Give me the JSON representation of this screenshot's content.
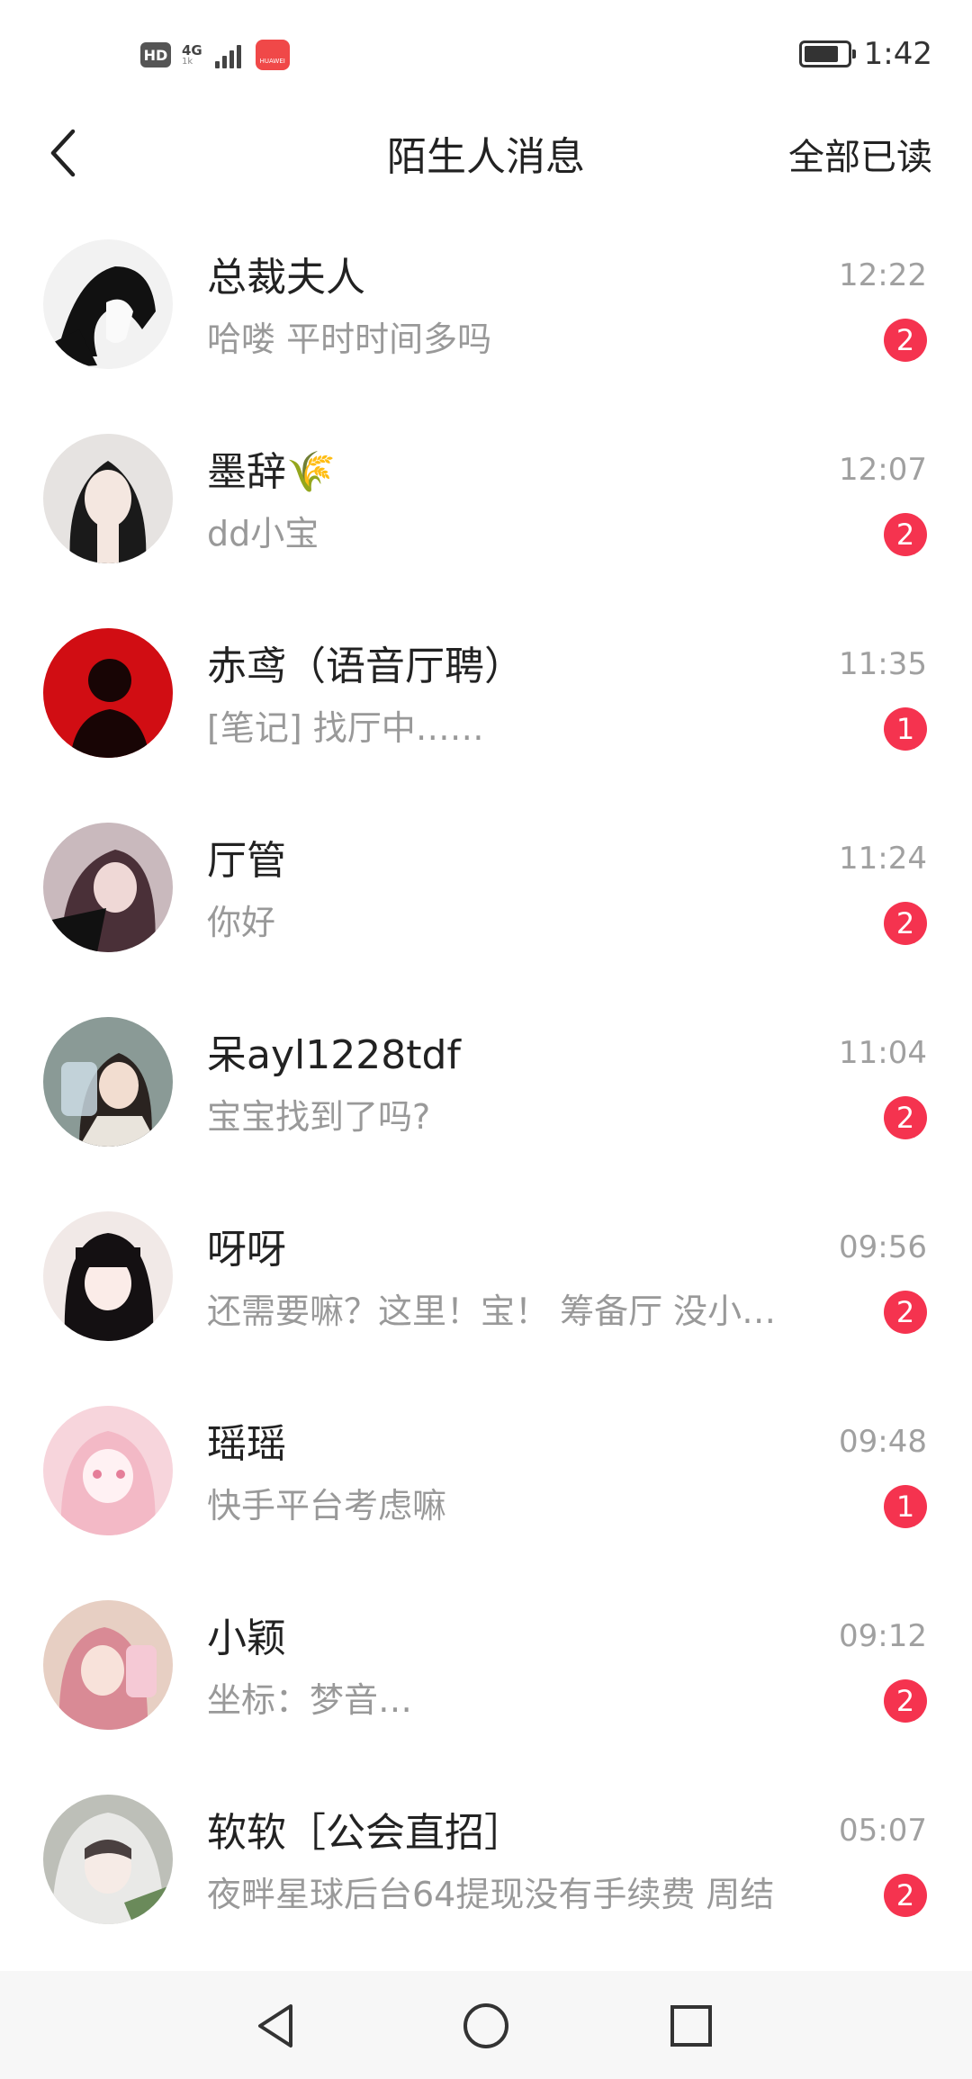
{
  "status_bar": {
    "hd": "HD",
    "network": "4G",
    "network_sub": "1k",
    "app_badge": "HUAWEI",
    "time": "1:42"
  },
  "header": {
    "title": "陌生人消息",
    "mark_all_read": "全部已读"
  },
  "messages": [
    {
      "name": "总裁夫人",
      "preview": "哈喽 平时时间多吗",
      "time": "12:22",
      "unread": "2"
    },
    {
      "name": "墨辞🌾",
      "preview": "dd小宝",
      "time": "12:07",
      "unread": "2"
    },
    {
      "name": "赤鸢（语音厅聘）",
      "preview": "[笔记] 找厅中……",
      "time": "11:35",
      "unread": "1"
    },
    {
      "name": "厅管",
      "preview": "你好",
      "time": "11:24",
      "unread": "2"
    },
    {
      "name": "呆ayl1228tdf",
      "preview": "宝宝找到了吗?",
      "time": "11:04",
      "unread": "2"
    },
    {
      "name": "呀呀",
      "preview": "还需要嘛？这里！宝！ 筹备厅 没小…",
      "time": "09:56",
      "unread": "2"
    },
    {
      "name": "瑶瑶",
      "preview": "快手平台考虑嘛",
      "time": "09:48",
      "unread": "1"
    },
    {
      "name": "小颖",
      "preview": "坐标：梦音…",
      "time": "09:12",
      "unread": "2"
    },
    {
      "name": "软软［公会直招］",
      "preview": "夜畔星球后台64提现没有手续费 周结",
      "time": "05:07",
      "unread": "2"
    }
  ],
  "colors": {
    "badge": "#f5334f",
    "preview_text": "#999999",
    "time_text": "#a0a0a0"
  },
  "icons": {
    "back": "chevron-left-icon",
    "nav_back": "triangle-back-icon",
    "nav_home": "circle-home-icon",
    "nav_recent": "square-recent-icon"
  }
}
